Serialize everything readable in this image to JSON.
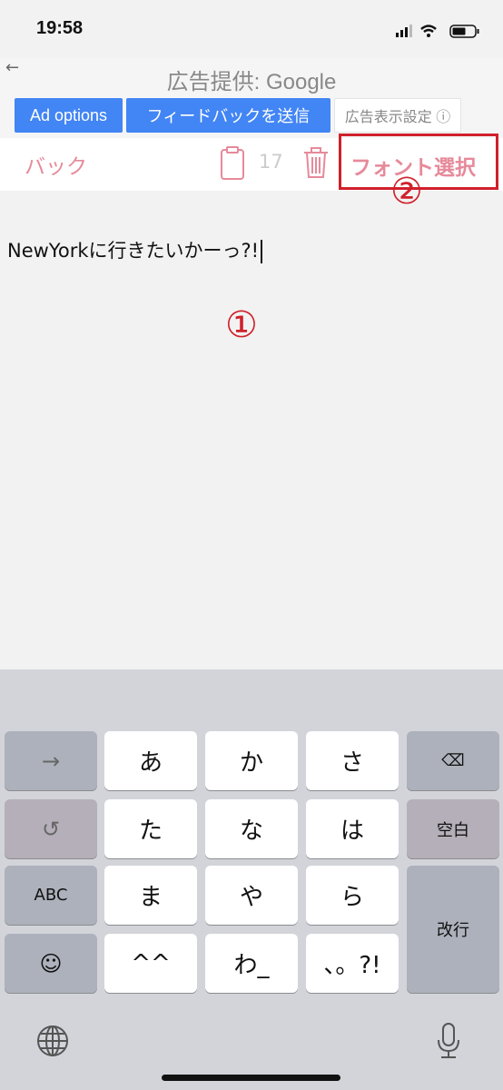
{
  "status": {
    "time": "19:58"
  },
  "ad": {
    "title": "広告提供: Google",
    "buttons": [
      "Ad options",
      "フィードバックを送信",
      "広告表示設定 ⓘ"
    ]
  },
  "toolbar": {
    "back": "バック",
    "count": "17",
    "font_select": "フォント選択"
  },
  "editor": {
    "text": "NewYorkに行きたいかーっ?!"
  },
  "annotations": {
    "one": "①",
    "two": "②"
  },
  "keyboard": {
    "rows": [
      [
        "→",
        "あ",
        "か",
        "さ",
        "⌫"
      ],
      [
        "↺",
        "た",
        "な",
        "は",
        "空白"
      ],
      [
        "ABC",
        "ま",
        "や",
        "ら",
        "改行"
      ],
      [
        "☺",
        "^^",
        "わ_",
        "、。?!"
      ]
    ]
  },
  "colors": {
    "accent": "#4285f4",
    "pink": "#e68a9a",
    "annotation": "#d0202a"
  }
}
